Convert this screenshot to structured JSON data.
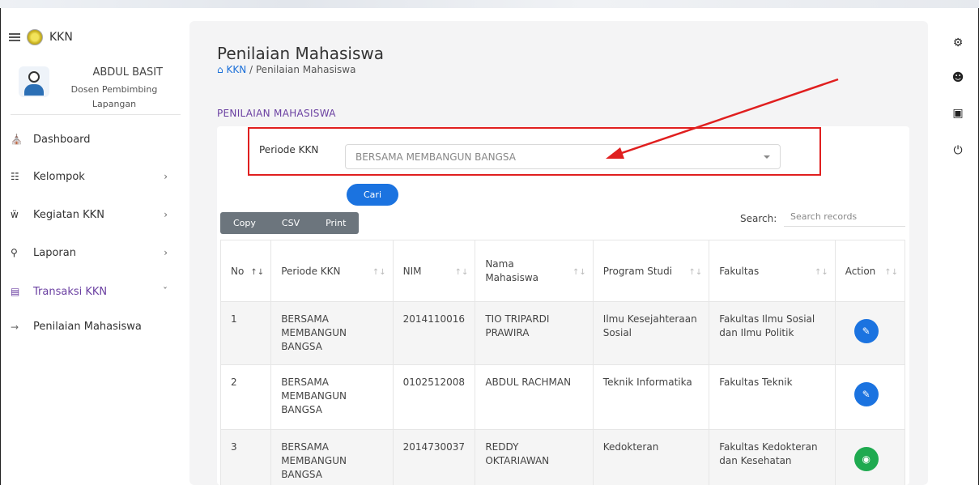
{
  "app": {
    "brand": "KKN"
  },
  "user": {
    "name": "ABDUL BASIT",
    "role": "Dosen Pembimbing Lapangan"
  },
  "sidebar": {
    "items": [
      {
        "label": "Dashboard",
        "icon": "home-icon"
      },
      {
        "label": "Kelompok",
        "icon": "group-icon"
      },
      {
        "label": "Kegiatan KKN",
        "icon": "activity-icon"
      },
      {
        "label": "Laporan",
        "icon": "report-icon"
      },
      {
        "label": "Transaksi KKN",
        "icon": "transaction-icon"
      }
    ],
    "sub_item": "Penilaian Mahasiswa"
  },
  "page": {
    "title": "Penilaian Mahasiswa",
    "breadcrumb_root": "KKN",
    "breadcrumb_sep": "/",
    "breadcrumb_current": "Penilaian Mahasiswa",
    "section_title": "PENILAIAN MAHASISWA"
  },
  "filter": {
    "label": "Periode KKN",
    "selected": "BERSAMA MEMBANGUN BANGSA",
    "submit_label": "Cari"
  },
  "export": {
    "copy": "Copy",
    "csv": "CSV",
    "print": "Print"
  },
  "search": {
    "label": "Search:",
    "placeholder": "Search records"
  },
  "table": {
    "headers": [
      "No",
      "Periode KKN",
      "NIM",
      "Nama Mahasiswa",
      "Program Studi",
      "Fakultas",
      "Action"
    ],
    "rows": [
      {
        "no": "1",
        "periode": "BERSAMA MEMBANGUN BANGSA",
        "nim": "2014110016",
        "nama": "TIO TRIPARDI PRAWIRA",
        "prodi": "Ilmu Kesejahteraan Sosial",
        "fakultas": "Fakultas Ilmu Sosial dan Ilmu Politik",
        "action": "edit"
      },
      {
        "no": "2",
        "periode": "BERSAMA MEMBANGUN BANGSA",
        "nim": "0102512008",
        "nama": "ABDUL RACHMAN",
        "prodi": "Teknik Informatika",
        "fakultas": "Fakultas Teknik",
        "action": "edit"
      },
      {
        "no": "3",
        "periode": "BERSAMA MEMBANGUN BANGSA",
        "nim": "2014730037",
        "nama": "REDDY OKTARIAWAN",
        "prodi": "Kedokteran",
        "fakultas": "Fakultas Kedokteran dan Kesehatan",
        "action": "view"
      }
    ]
  },
  "colors": {
    "accent_purple": "#6a3fa1",
    "primary_blue": "#1b73e0",
    "success_green": "#1faa50",
    "annotation_red": "#e01f1f"
  }
}
